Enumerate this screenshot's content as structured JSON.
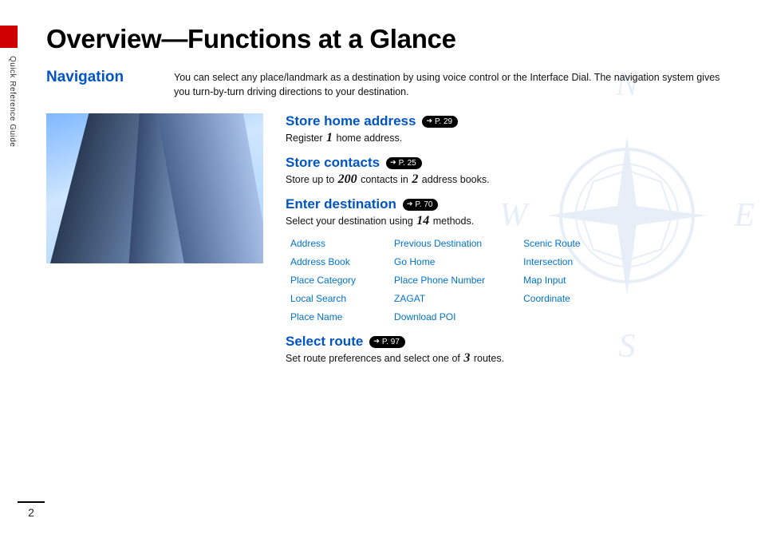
{
  "side_label": "Quick Reference Guide",
  "title": "Overview—Functions at a Glance",
  "section_label": "Navigation",
  "intro": "You can select any place/landmark as a destination by using voice control or the Interface Dial. The navigation system gives you turn-by-turn driving directions to your destination.",
  "features": {
    "store_home": {
      "title": "Store home address",
      "page_ref": "P. 29",
      "body_pre": "Register ",
      "body_num": "1",
      "body_post": " home address."
    },
    "store_contacts": {
      "title": "Store contacts",
      "page_ref": "P. 25",
      "body_pre": "Store up to ",
      "body_num1": "200",
      "body_mid": " contacts in ",
      "body_num2": "2",
      "body_post": " address books."
    },
    "enter_dest": {
      "title": "Enter destination",
      "page_ref": "P. 70",
      "body_pre": "Select your destination using ",
      "body_num": "14",
      "body_post": " methods."
    },
    "select_route": {
      "title": "Select route",
      "page_ref": "P. 97",
      "body_pre": "Set route preferences and select one of ",
      "body_num": "3",
      "body_post": " routes."
    }
  },
  "methods": {
    "col1": [
      "Address",
      "Address Book",
      "Place Category",
      "Local Search",
      "Place Name"
    ],
    "col2": [
      "Previous Destination",
      "Go Home",
      "Place Phone Number",
      "ZAGAT",
      "Download POI"
    ],
    "col3": [
      "Scenic Route",
      "Intersection",
      "Map Input",
      "Coordinate"
    ]
  },
  "compass": {
    "n": "N",
    "s": "S",
    "e": "E",
    "w": "W"
  },
  "page_number": "2"
}
